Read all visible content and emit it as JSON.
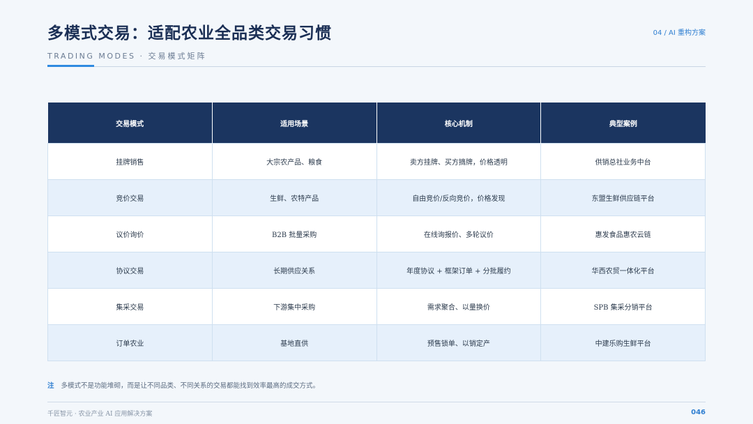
{
  "header": {
    "title": "多模式交易：适配农业全品类交易习惯",
    "section_tag": "04 / AI 重构方案",
    "subtitle_en": "TRADING MODES",
    "subtitle_sep": "·",
    "subtitle_cn": "交易模式矩阵"
  },
  "table": {
    "columns": [
      "交易模式",
      "适用场景",
      "核心机制",
      "典型案例"
    ],
    "rows": [
      [
        "挂牌销售",
        "大宗农产品、粮食",
        "卖方挂牌、买方摘牌，价格透明",
        "供销总社业务中台"
      ],
      [
        "竞价交易",
        "生鲜、农特产品",
        "自由竞价/反向竞价，价格发现",
        "东盟生鲜供应链平台"
      ],
      [
        "议价询价",
        "B2B 批量采购",
        "在线询报价、多轮议价",
        "惠发食品惠农云链"
      ],
      [
        "协议交易",
        "长期供应关系",
        "年度协议 + 框架订单 + 分批履约",
        "华西农贸一体化平台"
      ],
      [
        "集采交易",
        "下游集中采购",
        "需求聚合、以量换价",
        "SPB 集采分销平台"
      ],
      [
        "订单农业",
        "基地直供",
        "预售锁单、以销定产",
        "中建乐购生鲜平台"
      ]
    ]
  },
  "note": {
    "mark": "注",
    "text": "多模式不是功能堆砌，而是让不同品类、不同关系的交易都能找到效率最高的成交方式。"
  },
  "footer": {
    "left": "千匠智元 · 农业产业 AI 应用解决方案",
    "page": "046"
  },
  "colors": {
    "header_bg": "#1b3560",
    "accent": "#2f8ae0",
    "alt_row": "#e6f0fb"
  }
}
